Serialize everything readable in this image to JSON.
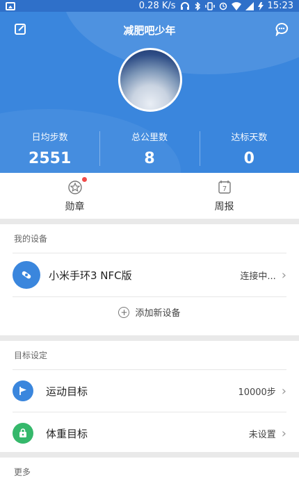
{
  "status_bar": {
    "speed": "0.28 K/s",
    "time": "15:23",
    "icons": [
      "gallery-icon",
      "headphones-icon",
      "bluetooth-icon",
      "vibrate-icon",
      "alarm-icon",
      "wifi-icon",
      "signal-icon",
      "battery-charging-icon"
    ]
  },
  "header": {
    "title": "减肥吧少年",
    "stats": [
      {
        "label": "日均步数",
        "value": "2551"
      },
      {
        "label": "总公里数",
        "value": "8"
      },
      {
        "label": "达标天数",
        "value": "0"
      }
    ]
  },
  "quick": {
    "items": [
      {
        "label": "勋章",
        "icon": "medal-icon",
        "has_badge": true
      },
      {
        "label": "周报",
        "icon": "calendar-icon",
        "calendar_day": "7"
      }
    ]
  },
  "devices": {
    "title": "我的设备",
    "device": {
      "name": "小米手环3 NFC版",
      "status": "连接中..."
    },
    "add_label": "添加新设备"
  },
  "goals": {
    "title": "目标设定",
    "items": [
      {
        "label": "运动目标",
        "value": "10000步",
        "icon": "flag-icon"
      },
      {
        "label": "体重目标",
        "value": "未设置",
        "icon": "bag-icon"
      }
    ]
  },
  "more": {
    "title": "更多"
  },
  "colors": {
    "primary": "#3a86dd",
    "status_bar": "#2f70c9",
    "badge": "#f04b4b",
    "weight_icon_bg": "#35b86b"
  }
}
